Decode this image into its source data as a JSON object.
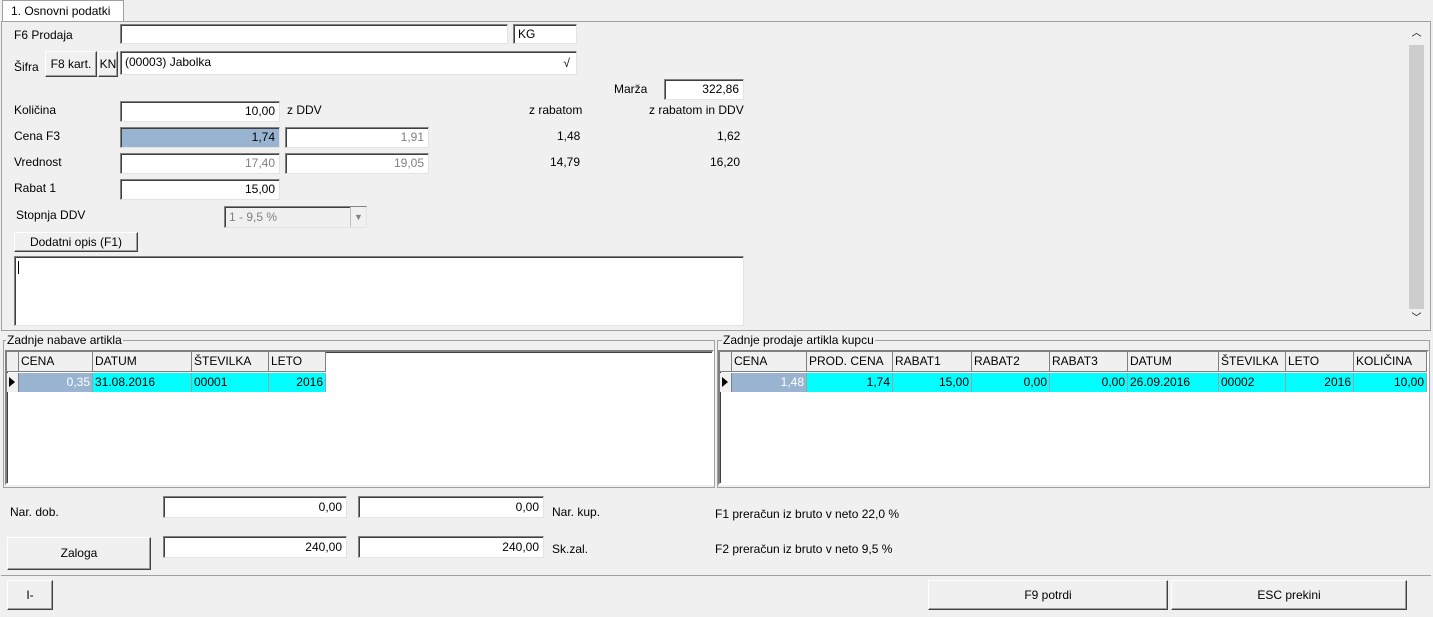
{
  "tab": {
    "label": "1. Osnovni podatki"
  },
  "form": {
    "f6_label": "F6 Prodaja",
    "f6_value": "",
    "unit": "KG",
    "sifra_label": "Šifra",
    "f8_button": "F8 kart.",
    "kn_button": "KN",
    "article_value": "(00003) Jabolka",
    "article_check": "√",
    "marza_label": "Marža",
    "marza_value": "322,86",
    "kolicina_label": "Količina",
    "kolicina_value": "10,00",
    "z_ddv_label": "z DDV",
    "z_rabatom_label": "z rabatom",
    "z_rabatom_ddv_label": "z rabatom in DDV",
    "cena_label": "Cena F3",
    "cena_value": "1,74",
    "cena_ddv_value": "1,91",
    "cena_rabat": "1,48",
    "cena_rabat_ddv": "1,62",
    "vrednost_label": "Vrednost",
    "vrednost_value": "17,40",
    "vrednost_ddv_value": "19,05",
    "vrednost_rabat": "14,79",
    "vrednost_rabat_ddv": "16,20",
    "rabat_label": "Rabat 1",
    "rabat_value": "15,00",
    "stopnja_label": "Stopnja DDV",
    "stopnja_value": "1 -  9,5 %",
    "dodatni_button": "Dodatni opis (F1)",
    "dodatni_text": ""
  },
  "nabave": {
    "title": "Zadnje nabave artikla",
    "columns": [
      "CENA",
      "DATUM",
      "ŠTEVILKA",
      "LETO"
    ],
    "rows": [
      [
        "0,35",
        "31.08.2016",
        "00001",
        "2016"
      ]
    ]
  },
  "prodaje": {
    "title": "Zadnje prodaje artikla kupcu",
    "columns": [
      "CENA",
      "PROD. CENA",
      "RABAT1",
      "RABAT2",
      "RABAT3",
      "DATUM",
      "ŠTEVILKA",
      "LETO",
      "KOLIČINA"
    ],
    "rows": [
      [
        "1,48",
        "1,74",
        "15,00",
        "0,00",
        "0,00",
        "26.09.2016",
        "00002",
        "2016",
        "10,00"
      ]
    ]
  },
  "bottom": {
    "nar_dob_label": "Nar. dob.",
    "nar_dob_value": "0,00",
    "nar_kup_value": "0,00",
    "nar_kup_label": "Nar. kup.",
    "zaloga_button": "Zaloga",
    "zaloga_value": "240,00",
    "skzal_value": "240,00",
    "skzal_label": "Sk.zal.",
    "f1_info": "F1 preračun iz bruto v neto 22,0 %",
    "f2_info": "F2 preračun iz bruto v neto  9,5 %"
  },
  "footer": {
    "i_button": "I-",
    "f9_button": "F9  potrdi",
    "esc_button": "ESC  prekini"
  },
  "colors": {
    "highlight_row": "#00ffff",
    "selected_field": "#99b4d1"
  },
  "icons": {
    "scroll_up": "chevron-up-icon",
    "scroll_down": "chevron-down-icon",
    "dropdown": "chevron-down-icon",
    "row_indicator": "triangle-right-icon"
  }
}
